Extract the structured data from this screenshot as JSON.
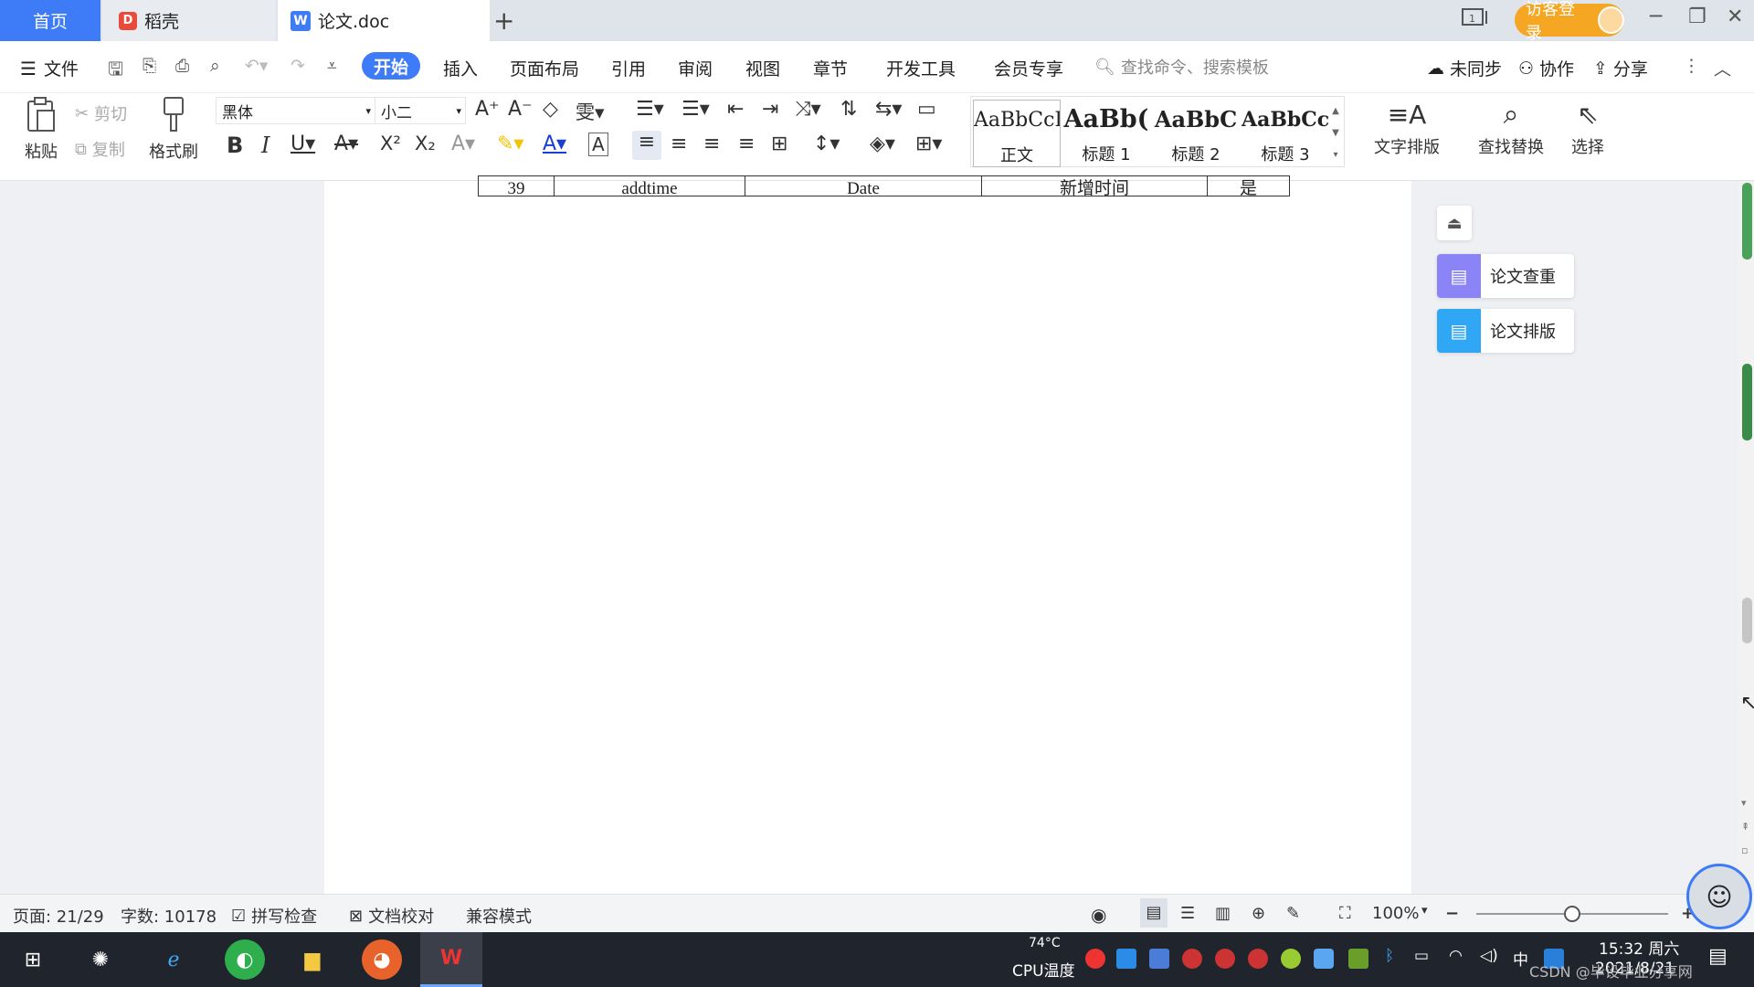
{
  "tabs": {
    "home": "首页",
    "daoke": "稻壳",
    "doc": "论文.doc",
    "new_tab": "+",
    "login": "访客登录"
  },
  "menu": {
    "file": "文件",
    "items": [
      "开始",
      "插入",
      "页面布局",
      "引用",
      "审阅",
      "视图",
      "章节",
      "开发工具",
      "会员专享"
    ],
    "search_placeholder": "查找命令、搜索模板",
    "unsync": "未同步",
    "collab": "协作",
    "share": "分享"
  },
  "ribbon": {
    "paste": "粘贴",
    "cut": "剪切",
    "copy": "复制",
    "format_painter": "格式刷",
    "font_name": "黑体",
    "font_size": "小二",
    "styles": [
      {
        "sample": "AaBbCcI",
        "label": "正文"
      },
      {
        "sample": "AaBb(",
        "label": "标题 1"
      },
      {
        "sample": "AaBbC",
        "label": "标题 2"
      },
      {
        "sample": "AaBbCcl",
        "label": "标题 3"
      }
    ],
    "text_layout": "文字排版",
    "find_replace": "查找替换",
    "select": "选择"
  },
  "doc_table": {
    "row": [
      "39",
      "addtime",
      "Date",
      "新增时间",
      "是"
    ]
  },
  "side_panel": {
    "check": "论文查重",
    "layout": "论文排版"
  },
  "status": {
    "page": "页面: 21/29",
    "words": "字数: 10178",
    "spell": "拼写检查",
    "proof": "文档校对",
    "compat": "兼容模式",
    "zoom": "100%",
    "zoom_level": 0.5
  },
  "taskbar": {
    "temp": "74°C",
    "temp_label": "CPU温度",
    "ime": "中",
    "time": "15:32 周六",
    "date": "2021/8/21",
    "watermark": "CSDN @毕设毕业分享网"
  }
}
